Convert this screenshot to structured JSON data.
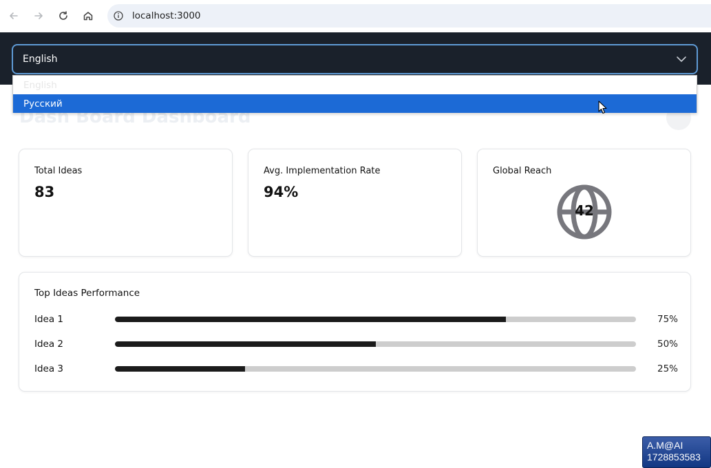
{
  "browser": {
    "url": "localhost:3000"
  },
  "header": {
    "language_selected": "English"
  },
  "dropdown": {
    "options": [
      "English",
      "Русский"
    ],
    "highlighted": "Русский"
  },
  "main": {
    "title": "Dash Board Dashboard",
    "cards": [
      {
        "label": "Total Ideas",
        "value": "83"
      },
      {
        "label": "Avg. Implementation Rate",
        "value": "94%"
      },
      {
        "label": "Global Reach",
        "value": "42"
      }
    ],
    "performance": {
      "title": "Top Ideas Performance",
      "items": [
        {
          "name": "Idea 1",
          "percent_label": "75%",
          "fraction": 0.75
        },
        {
          "name": "Idea 2",
          "percent_label": "50%",
          "fraction": 0.5
        },
        {
          "name": "Idea 3",
          "percent_label": "25%",
          "fraction": 0.25
        }
      ]
    }
  },
  "watermark": {
    "line1": "A.M@AI",
    "line2": "1728853583"
  },
  "colors": {
    "header_bg": "#1a212b",
    "select_border": "#5f9bd6",
    "highlight": "#1c6ad6",
    "bar_fill": "#1b1b1b",
    "bar_track": "#cdcdcd"
  }
}
